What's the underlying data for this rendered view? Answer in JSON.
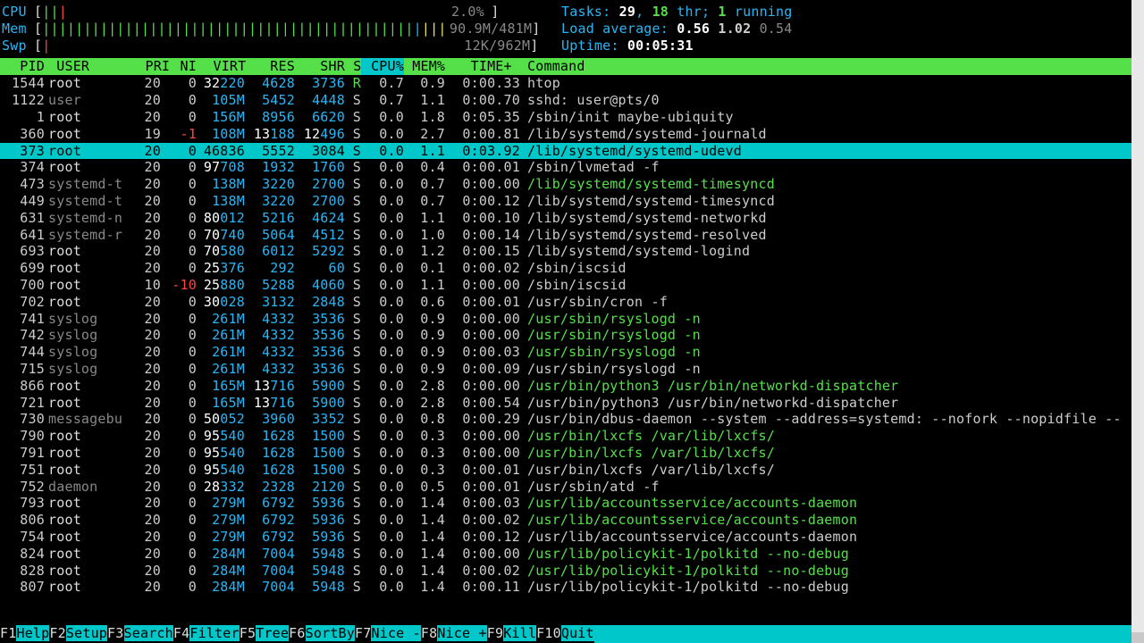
{
  "header": {
    "cpu": {
      "label": "CPU",
      "value": "2.0%"
    },
    "mem": {
      "label": "Mem",
      "value": "90.9M/481M"
    },
    "swp": {
      "label": "Swp",
      "value": "12K/962M"
    },
    "tasks": {
      "label": "Tasks: ",
      "procs": "29",
      "thr_lbl": ", ",
      "threads": "18",
      "thr_suf": " thr; ",
      "run": "1",
      "run_suf": " running"
    },
    "load": {
      "label": "Load average: ",
      "l1": "0.56",
      "l2": "1.02",
      "l3": "0.54"
    },
    "uptime": {
      "label": "Uptime: ",
      "value": "00:05:31"
    }
  },
  "columns": [
    "  PID",
    " USER     ",
    "  PRI",
    "  NI",
    "  VIRT",
    "   RES",
    "   SHR",
    " S",
    " CPU%",
    " MEM%",
    "   TIME+ ",
    "Command"
  ],
  "sort_col_index": 8,
  "rows": [
    {
      "pid": "1544",
      "user": "root",
      "pri": "20",
      "ni": "0",
      "virt": "32220",
      "virt_hi": "32",
      "res": "4628",
      "shr": "3736",
      "s": "R",
      "cpu": "0.7",
      "mem": "0.9",
      "time": "0:00.33",
      "cmd": "htop",
      "uroot": true
    },
    {
      "pid": "1122",
      "user": "user",
      "pri": "20",
      "ni": "0",
      "virt": "105M",
      "res": "5452",
      "shr": "4448",
      "s": "S",
      "cpu": "0.7",
      "mem": "1.1",
      "time": "0:00.70",
      "cmd": "sshd: user@pts/0"
    },
    {
      "pid": "1",
      "user": "root",
      "pri": "20",
      "ni": "0",
      "virt": "156M",
      "res": "8956",
      "shr": "6620",
      "s": "S",
      "cpu": "0.0",
      "mem": "1.8",
      "time": "0:05.35",
      "cmd": "/sbin/init maybe-ubiquity",
      "uroot": true
    },
    {
      "pid": "360",
      "user": "root",
      "pri": "19",
      "ni": "-1",
      "virt": "108M",
      "res": "13188",
      "res_hi": "13",
      "shr": "12496",
      "shr_hi": "12",
      "s": "S",
      "cpu": "0.0",
      "mem": "2.7",
      "time": "0:00.81",
      "cmd": "/lib/systemd/systemd-journald",
      "uroot": true
    },
    {
      "pid": "373",
      "user": "root",
      "pri": "20",
      "ni": "0",
      "virt": "46836",
      "virt_hi": "46",
      "res": "5552",
      "shr": "3084",
      "s": "S",
      "cpu": "0.0",
      "mem": "1.1",
      "time": "0:03.92",
      "cmd": "/lib/systemd/systemd-udevd",
      "uroot": true,
      "sel": true
    },
    {
      "pid": "374",
      "user": "root",
      "pri": "20",
      "ni": "0",
      "virt": "97708",
      "virt_hi": "97",
      "res": "1932",
      "shr": "1760",
      "s": "S",
      "cpu": "0.0",
      "mem": "0.4",
      "time": "0:00.01",
      "cmd": "/sbin/lvmetad -f",
      "uroot": true
    },
    {
      "pid": "473",
      "user": "systemd-t",
      "pri": "20",
      "ni": "0",
      "virt": "138M",
      "res": "3220",
      "shr": "2700",
      "s": "S",
      "cpu": "0.0",
      "mem": "0.7",
      "time": "0:00.00",
      "cmd": "/lib/systemd/systemd-timesyncd",
      "thr": true
    },
    {
      "pid": "449",
      "user": "systemd-t",
      "pri": "20",
      "ni": "0",
      "virt": "138M",
      "res": "3220",
      "shr": "2700",
      "s": "S",
      "cpu": "0.0",
      "mem": "0.7",
      "time": "0:00.12",
      "cmd": "/lib/systemd/systemd-timesyncd"
    },
    {
      "pid": "631",
      "user": "systemd-n",
      "pri": "20",
      "ni": "0",
      "virt": "80012",
      "virt_hi": "80",
      "res": "5216",
      "shr": "4624",
      "s": "S",
      "cpu": "0.0",
      "mem": "1.1",
      "time": "0:00.10",
      "cmd": "/lib/systemd/systemd-networkd"
    },
    {
      "pid": "641",
      "user": "systemd-r",
      "pri": "20",
      "ni": "0",
      "virt": "70740",
      "virt_hi": "70",
      "res": "5064",
      "shr": "4512",
      "s": "S",
      "cpu": "0.0",
      "mem": "1.0",
      "time": "0:00.14",
      "cmd": "/lib/systemd/systemd-resolved"
    },
    {
      "pid": "693",
      "user": "root",
      "pri": "20",
      "ni": "0",
      "virt": "70580",
      "virt_hi": "70",
      "res": "6012",
      "shr": "5292",
      "s": "S",
      "cpu": "0.0",
      "mem": "1.2",
      "time": "0:00.15",
      "cmd": "/lib/systemd/systemd-logind",
      "uroot": true
    },
    {
      "pid": "699",
      "user": "root",
      "pri": "20",
      "ni": "0",
      "virt": "25376",
      "virt_hi": "25",
      "res": "292",
      "shr": "60",
      "s": "S",
      "cpu": "0.0",
      "mem": "0.1",
      "time": "0:00.02",
      "cmd": "/sbin/iscsid",
      "uroot": true
    },
    {
      "pid": "700",
      "user": "root",
      "pri": "10",
      "ni": "-10",
      "virt": "25880",
      "virt_hi": "25",
      "res": "5288",
      "shr": "4060",
      "s": "S",
      "cpu": "0.0",
      "mem": "1.1",
      "time": "0:00.00",
      "cmd": "/sbin/iscsid",
      "uroot": true
    },
    {
      "pid": "702",
      "user": "root",
      "pri": "20",
      "ni": "0",
      "virt": "30028",
      "virt_hi": "30",
      "res": "3132",
      "shr": "2848",
      "s": "S",
      "cpu": "0.0",
      "mem": "0.6",
      "time": "0:00.01",
      "cmd": "/usr/sbin/cron -f",
      "uroot": true
    },
    {
      "pid": "741",
      "user": "syslog",
      "pri": "20",
      "ni": "0",
      "virt": "261M",
      "res": "4332",
      "shr": "3536",
      "s": "S",
      "cpu": "0.0",
      "mem": "0.9",
      "time": "0:00.00",
      "cmd": "/usr/sbin/rsyslogd -n",
      "thr": true
    },
    {
      "pid": "742",
      "user": "syslog",
      "pri": "20",
      "ni": "0",
      "virt": "261M",
      "res": "4332",
      "shr": "3536",
      "s": "S",
      "cpu": "0.0",
      "mem": "0.9",
      "time": "0:00.00",
      "cmd": "/usr/sbin/rsyslogd -n",
      "thr": true
    },
    {
      "pid": "744",
      "user": "syslog",
      "pri": "20",
      "ni": "0",
      "virt": "261M",
      "res": "4332",
      "shr": "3536",
      "s": "S",
      "cpu": "0.0",
      "mem": "0.9",
      "time": "0:00.03",
      "cmd": "/usr/sbin/rsyslogd -n",
      "thr": true
    },
    {
      "pid": "715",
      "user": "syslog",
      "pri": "20",
      "ni": "0",
      "virt": "261M",
      "res": "4332",
      "shr": "3536",
      "s": "S",
      "cpu": "0.0",
      "mem": "0.9",
      "time": "0:00.09",
      "cmd": "/usr/sbin/rsyslogd -n"
    },
    {
      "pid": "866",
      "user": "root",
      "pri": "20",
      "ni": "0",
      "virt": "165M",
      "res": "13716",
      "res_hi": "13",
      "shr": "5900",
      "s": "S",
      "cpu": "0.0",
      "mem": "2.8",
      "time": "0:00.00",
      "cmd": "/usr/bin/python3 /usr/bin/networkd-dispatcher",
      "uroot": true,
      "thr": true
    },
    {
      "pid": "721",
      "user": "root",
      "pri": "20",
      "ni": "0",
      "virt": "165M",
      "res": "13716",
      "res_hi": "13",
      "shr": "5900",
      "s": "S",
      "cpu": "0.0",
      "mem": "2.8",
      "time": "0:00.54",
      "cmd": "/usr/bin/python3 /usr/bin/networkd-dispatcher",
      "uroot": true
    },
    {
      "pid": "730",
      "user": "messagebu",
      "pri": "20",
      "ni": "0",
      "virt": "50052",
      "virt_hi": "50",
      "res": "3960",
      "shr": "3352",
      "s": "S",
      "cpu": "0.0",
      "mem": "0.8",
      "time": "0:00.29",
      "cmd": "/usr/bin/dbus-daemon --system --address=systemd: --nofork --nopidfile --"
    },
    {
      "pid": "790",
      "user": "root",
      "pri": "20",
      "ni": "0",
      "virt": "95540",
      "virt_hi": "95",
      "res": "1628",
      "shr": "1500",
      "s": "S",
      "cpu": "0.0",
      "mem": "0.3",
      "time": "0:00.00",
      "cmd": "/usr/bin/lxcfs /var/lib/lxcfs/",
      "uroot": true,
      "thr": true
    },
    {
      "pid": "791",
      "user": "root",
      "pri": "20",
      "ni": "0",
      "virt": "95540",
      "virt_hi": "95",
      "res": "1628",
      "shr": "1500",
      "s": "S",
      "cpu": "0.0",
      "mem": "0.3",
      "time": "0:00.00",
      "cmd": "/usr/bin/lxcfs /var/lib/lxcfs/",
      "uroot": true,
      "thr": true
    },
    {
      "pid": "751",
      "user": "root",
      "pri": "20",
      "ni": "0",
      "virt": "95540",
      "virt_hi": "95",
      "res": "1628",
      "shr": "1500",
      "s": "S",
      "cpu": "0.0",
      "mem": "0.3",
      "time": "0:00.01",
      "cmd": "/usr/bin/lxcfs /var/lib/lxcfs/",
      "uroot": true
    },
    {
      "pid": "752",
      "user": "daemon",
      "pri": "20",
      "ni": "0",
      "virt": "28332",
      "virt_hi": "28",
      "res": "2328",
      "shr": "2120",
      "s": "S",
      "cpu": "0.0",
      "mem": "0.5",
      "time": "0:00.01",
      "cmd": "/usr/sbin/atd -f"
    },
    {
      "pid": "793",
      "user": "root",
      "pri": "20",
      "ni": "0",
      "virt": "279M",
      "res": "6792",
      "shr": "5936",
      "s": "S",
      "cpu": "0.0",
      "mem": "1.4",
      "time": "0:00.03",
      "cmd": "/usr/lib/accountsservice/accounts-daemon",
      "uroot": true,
      "thr": true
    },
    {
      "pid": "806",
      "user": "root",
      "pri": "20",
      "ni": "0",
      "virt": "279M",
      "res": "6792",
      "shr": "5936",
      "s": "S",
      "cpu": "0.0",
      "mem": "1.4",
      "time": "0:00.02",
      "cmd": "/usr/lib/accountsservice/accounts-daemon",
      "uroot": true,
      "thr": true
    },
    {
      "pid": "754",
      "user": "root",
      "pri": "20",
      "ni": "0",
      "virt": "279M",
      "res": "6792",
      "shr": "5936",
      "s": "S",
      "cpu": "0.0",
      "mem": "1.4",
      "time": "0:00.12",
      "cmd": "/usr/lib/accountsservice/accounts-daemon",
      "uroot": true
    },
    {
      "pid": "824",
      "user": "root",
      "pri": "20",
      "ni": "0",
      "virt": "284M",
      "res": "7004",
      "shr": "5948",
      "s": "S",
      "cpu": "0.0",
      "mem": "1.4",
      "time": "0:00.00",
      "cmd": "/usr/lib/policykit-1/polkitd --no-debug",
      "uroot": true,
      "thr": true
    },
    {
      "pid": "828",
      "user": "root",
      "pri": "20",
      "ni": "0",
      "virt": "284M",
      "res": "7004",
      "shr": "5948",
      "s": "S",
      "cpu": "0.0",
      "mem": "1.4",
      "time": "0:00.02",
      "cmd": "/usr/lib/policykit-1/polkitd --no-debug",
      "uroot": true,
      "thr": true
    },
    {
      "pid": "807",
      "user": "root",
      "pri": "20",
      "ni": "0",
      "virt": "284M",
      "res": "7004",
      "shr": "5948",
      "s": "S",
      "cpu": "0.0",
      "mem": "1.4",
      "time": "0:00.11",
      "cmd": "/usr/lib/policykit-1/polkitd --no-debug",
      "uroot": true
    }
  ],
  "footer": [
    {
      "k": "F1",
      "l": "Help  "
    },
    {
      "k": "F2",
      "l": "Setup "
    },
    {
      "k": "F3",
      "l": "Search"
    },
    {
      "k": "F4",
      "l": "Filter"
    },
    {
      "k": "F5",
      "l": "Tree  "
    },
    {
      "k": "F6",
      "l": "SortBy"
    },
    {
      "k": "F7",
      "l": "Nice -"
    },
    {
      "k": "F8",
      "l": "Nice +"
    },
    {
      "k": "F9",
      "l": "Kill  "
    },
    {
      "k": "F10",
      "l": "Quit  "
    }
  ]
}
